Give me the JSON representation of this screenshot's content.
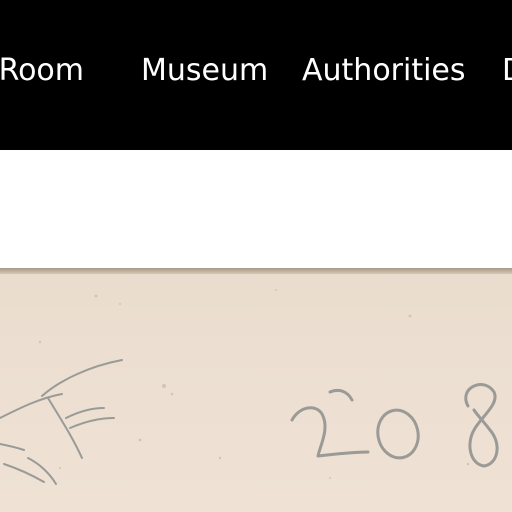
{
  "nav": {
    "items": [
      {
        "label": "g Room"
      },
      {
        "label": "Museum"
      },
      {
        "label": "Authorities"
      },
      {
        "label": "D"
      }
    ]
  },
  "document": {
    "handwritten_number": "208",
    "colors": {
      "paper": "#ecdfd1",
      "pencil": "#9a9a96",
      "nav_background": "#000000",
      "nav_text": "#ffffff"
    }
  }
}
